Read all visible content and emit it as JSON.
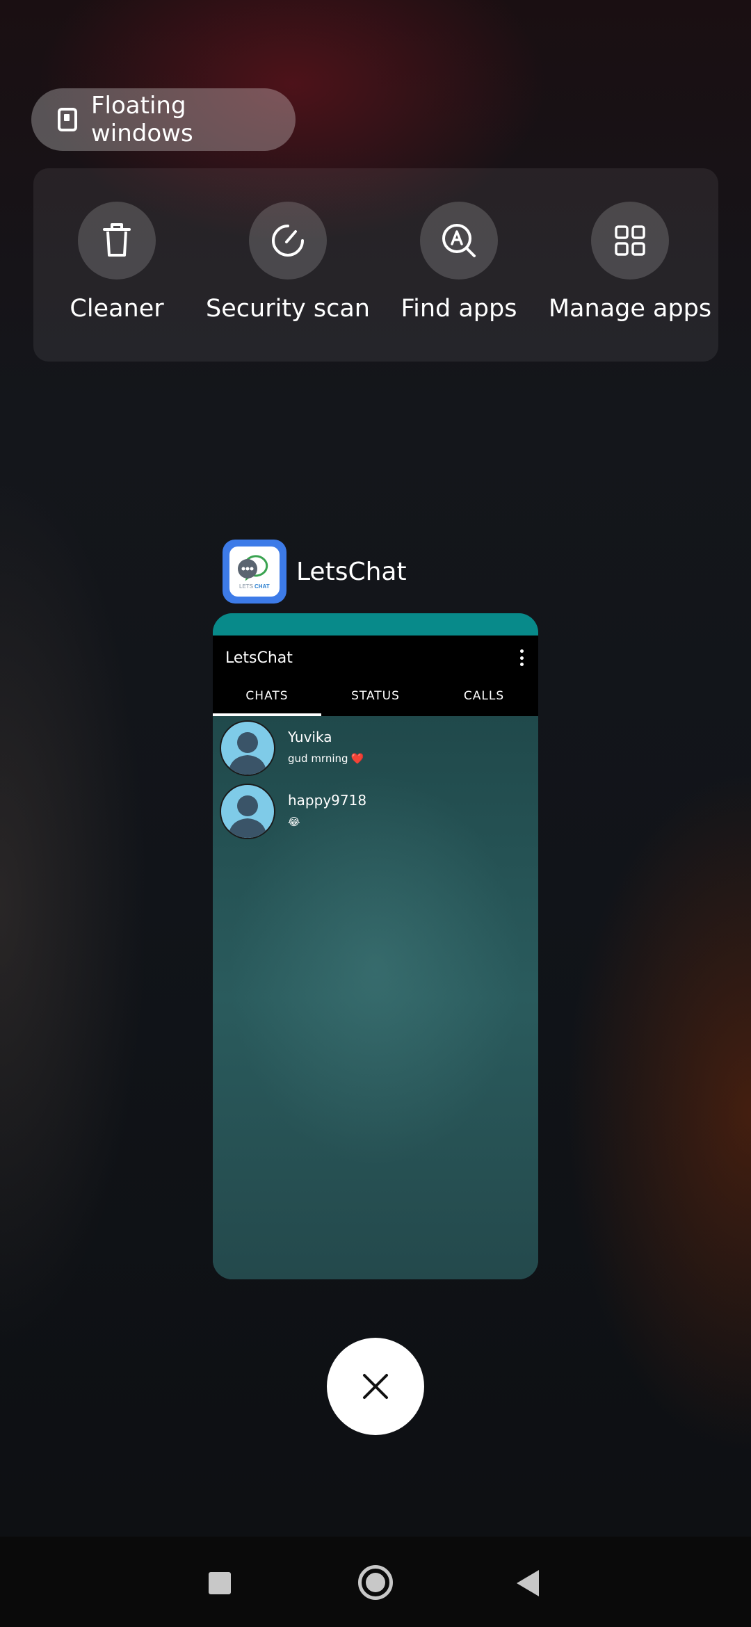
{
  "floating": {
    "label": "Floating windows"
  },
  "tools": [
    {
      "label": "Cleaner",
      "icon": "trash-icon"
    },
    {
      "label": "Security scan",
      "icon": "gauge-icon"
    },
    {
      "label": "Find apps",
      "icon": "find-apps-icon"
    },
    {
      "label": "Manage apps",
      "icon": "grid-icon"
    }
  ],
  "app": {
    "name": "LetsChat",
    "icon_caption_lets": "LETS",
    "icon_caption_chat": "CHAT",
    "preview": {
      "title": "LetsChat",
      "tabs": [
        "CHATS",
        "STATUS",
        "CALLS"
      ],
      "active_tab": "CHATS",
      "chats": [
        {
          "name": "Yuvika",
          "message": "gud mrning",
          "emoji": "❤️"
        },
        {
          "name": "happy9718",
          "message": "",
          "emoji": "😂"
        }
      ]
    }
  },
  "colors": {
    "preview_status": "#088a8a",
    "preview_bg": "#2c5a5c",
    "app_icon_blue": "#3d7be8",
    "avatar_blue": "#7fcbe8"
  }
}
